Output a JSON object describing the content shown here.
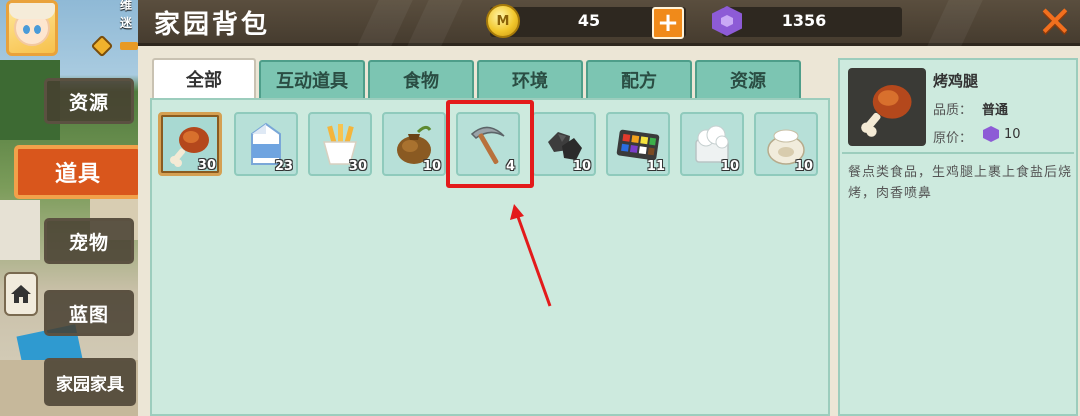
{
  "player": {
    "name_partial": "维",
    "sub_partial": "迷"
  },
  "header": {
    "title": "家园背包",
    "coins": "45",
    "gems": "1356",
    "coin_icon_glyph": "M",
    "add_glyph": "+",
    "close_glyph": "✕"
  },
  "sidebar": {
    "items": [
      {
        "label": "资源",
        "active": false
      },
      {
        "label": "道具",
        "active": true
      },
      {
        "label": "宠物",
        "active": false
      },
      {
        "label": "蓝图",
        "active": false
      },
      {
        "label": "家园家具",
        "active": false
      }
    ]
  },
  "tabs": [
    {
      "label": "全部",
      "active": true
    },
    {
      "label": "互动道具",
      "active": false
    },
    {
      "label": "食物",
      "active": false
    },
    {
      "label": "环境",
      "active": false
    },
    {
      "label": "配方",
      "active": false
    },
    {
      "label": "资源",
      "active": false
    }
  ],
  "inventory": [
    {
      "icon": "roast-drumstick-icon",
      "count": "30",
      "selected": true
    },
    {
      "icon": "milk-carton-icon",
      "count": "23",
      "selected": false
    },
    {
      "icon": "fries-icon",
      "count": "30",
      "selected": false
    },
    {
      "icon": "seed-bag-icon",
      "count": "10",
      "selected": false
    },
    {
      "icon": "pickaxe-icon",
      "count": "4",
      "selected": false,
      "highlighted": true
    },
    {
      "icon": "coal-icon",
      "count": "10",
      "selected": false
    },
    {
      "icon": "paint-palette-icon",
      "count": "11",
      "selected": false
    },
    {
      "icon": "cotton-icon",
      "count": "10",
      "selected": false
    },
    {
      "icon": "flour-sack-icon",
      "count": "10",
      "selected": false
    }
  ],
  "detail": {
    "name": "烤鸡腿",
    "quality_label": "品质：",
    "quality_value": "普通",
    "price_label": "原价：",
    "price_value": "10",
    "description": "餐点类食品，生鸡腿上裹上食盐后烧烤，肉香喷鼻"
  },
  "colors": {
    "highlight": "#e31b1b",
    "active_nav": "#d9561c",
    "tab": "#7cc5b2",
    "panel": "#cdeade"
  }
}
